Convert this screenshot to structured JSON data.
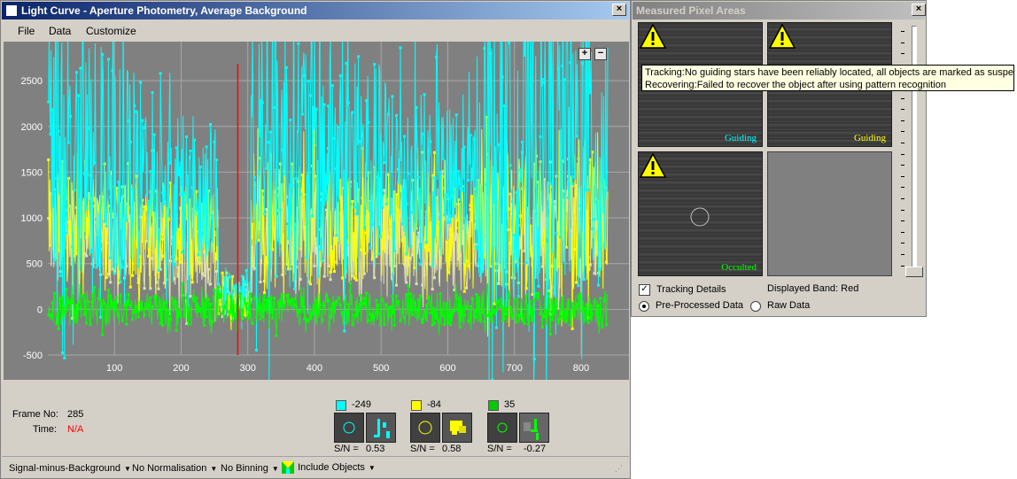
{
  "light_curve": {
    "title": "Light Curve - Aperture Photometry, Average Background",
    "menu": [
      "File",
      "Data",
      "Customize"
    ],
    "zoom_in": "+",
    "zoom_out": "−",
    "frame_no_label": "Frame No:",
    "frame_no": "285",
    "time_label": "Time:",
    "time_value": "N/A",
    "objects": [
      {
        "color": "#00ffff",
        "value": "-249",
        "sn_label": "S/N =",
        "sn": "0.53"
      },
      {
        "color": "#ffff00",
        "value": "-84",
        "sn_label": "S/N =",
        "sn": "0.58"
      },
      {
        "color": "#00cc00",
        "value": "35",
        "sn_label": "S/N =",
        "sn": "-0.27"
      }
    ],
    "status": {
      "signal": "Signal-minus-Background",
      "normalisation": "No Normalisation",
      "binning": "No Binning",
      "include": "Include Objects"
    }
  },
  "chart_data": {
    "type": "line",
    "xlim": [
      0,
      840
    ],
    "ylim": [
      -500,
      2850
    ],
    "x_ticks": [
      100,
      200,
      300,
      400,
      500,
      600,
      700,
      800
    ],
    "y_ticks": [
      -500,
      0,
      500,
      1000,
      1500,
      2000,
      2500
    ],
    "grid": true,
    "cursor_frame": 285,
    "background": "#808080",
    "series": [
      {
        "color": "#00ffff",
        "segments": [
          [
            0,
            1800,
            1600
          ],
          [
            240,
            1200,
            700
          ],
          [
            300,
            1850,
            1700
          ],
          [
            640,
            1300,
            800
          ],
          [
            660,
            1800,
            1700
          ],
          [
            840,
            1750,
            1700
          ]
        ]
      },
      {
        "color": "#ffff00",
        "segments": [
          [
            0,
            950,
            700
          ],
          [
            240,
            800,
            500
          ],
          [
            300,
            1000,
            800
          ],
          [
            640,
            900,
            500
          ],
          [
            660,
            950,
            800
          ],
          [
            840,
            950,
            800
          ]
        ]
      },
      {
        "color": "#e0e0b0",
        "segments": [
          [
            0,
            900,
            500
          ],
          [
            240,
            600,
            500
          ],
          [
            300,
            900,
            600
          ],
          [
            640,
            700,
            500
          ],
          [
            660,
            900,
            600
          ],
          [
            840,
            900,
            600
          ]
        ]
      },
      {
        "color": "#00ff00",
        "segments": [
          [
            0,
            0,
            180
          ],
          [
            840,
            0,
            180
          ]
        ]
      }
    ]
  },
  "pixel_areas": {
    "title": "Measured Pixel Areas",
    "cells": [
      {
        "label": "Guiding",
        "label_color": "#00ffff",
        "warning": true
      },
      {
        "label": "Guiding",
        "label_color": "#ffff00",
        "warning": true
      },
      {
        "label": "Occulted",
        "label_color": "#00ff00",
        "warning": true
      },
      {
        "label": "",
        "label_color": "#000000",
        "warning": false
      }
    ],
    "tooltip_line1": "Tracking:No guiding stars have been reliably located, all objects are marked as suspect",
    "tooltip_line2": "Recovering:Failed to recover the object after using pattern recognition",
    "tracking_details": "Tracking Details",
    "displayed_band": "Displayed Band: Red",
    "pre_processed": "Pre-Processed Data",
    "raw_data": "Raw Data"
  }
}
